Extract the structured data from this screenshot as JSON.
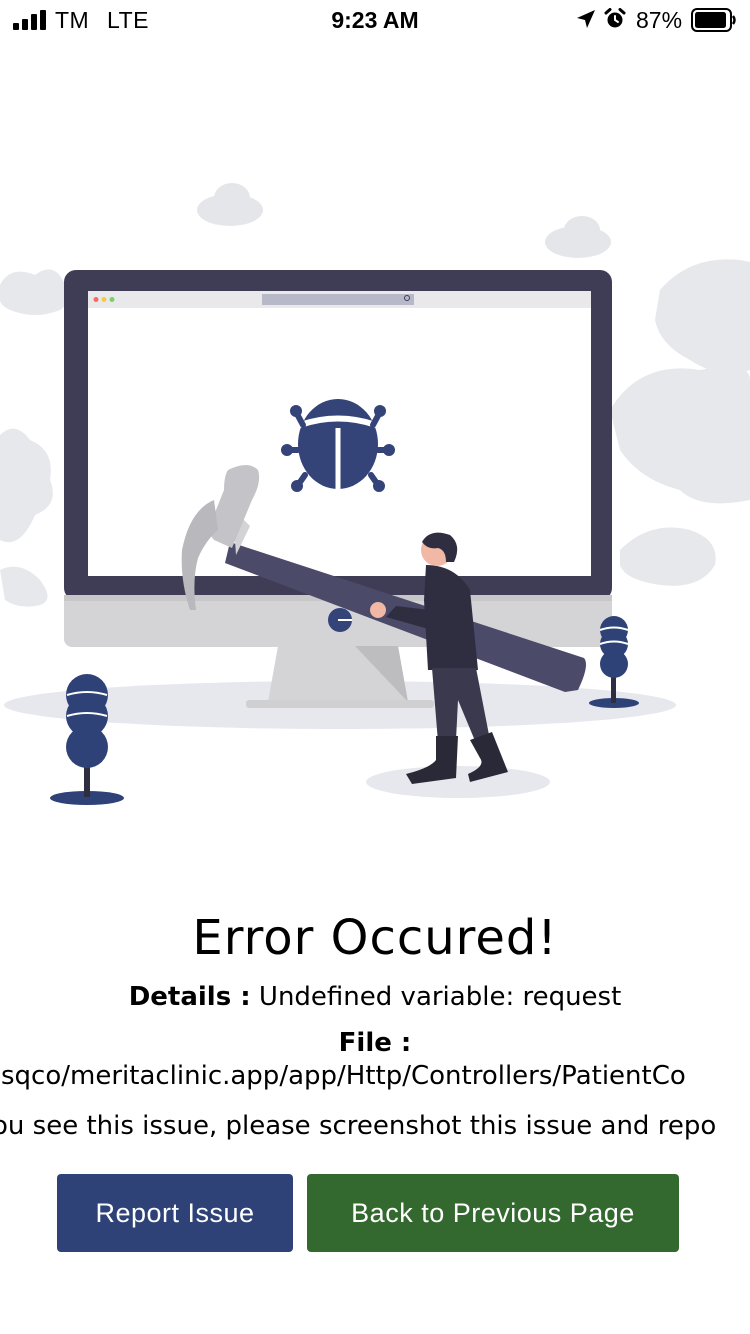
{
  "status_bar": {
    "carrier": "TM",
    "network": "LTE",
    "time": "9:23 AM",
    "battery_percent": "87%",
    "icons": [
      "signal-icon",
      "location-icon",
      "alarm-icon",
      "battery-icon"
    ]
  },
  "illustration": {
    "subject": "bug-on-monitor-with-hammer"
  },
  "error": {
    "title": "Error Occured!",
    "details_label": "Details :",
    "details_value": "Undefined variable: request",
    "file_label": "File :",
    "file_path": "esqco/meritaclinic.app/app/Http/Controllers/PatientCo",
    "notice": "ou see this issue, please screenshot this issue and repo"
  },
  "buttons": {
    "report_label": "Report Issue",
    "back_label": "Back to Previous Page"
  },
  "colors": {
    "report_button": "#2e4277",
    "back_button": "#33692f",
    "bug": "#3a4a82",
    "monitor_frame": "#3f3d56"
  }
}
